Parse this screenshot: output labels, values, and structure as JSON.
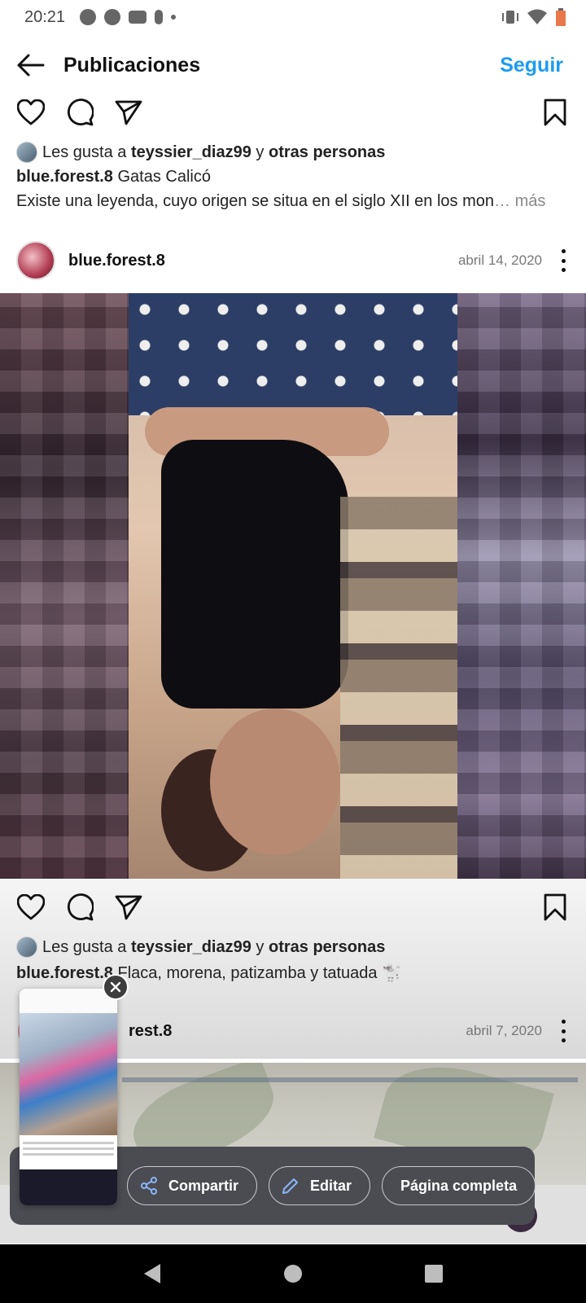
{
  "status_bar": {
    "time": "20:21"
  },
  "header": {
    "title": "Publicaciones",
    "follow_label": "Seguir"
  },
  "post1": {
    "likes": {
      "prefix": "Les gusta a ",
      "user": "teyssier_diaz99",
      "middle": " y ",
      "others": "otras personas"
    },
    "caption": {
      "username": "blue.forest.8",
      "text": " Gatas Calicó"
    },
    "caption_more": {
      "text": "Existe una leyenda, cuyo origen se situa en el siglo XII en los mon",
      "ellipsis": "…",
      "more": " más"
    }
  },
  "post2": {
    "username": "blue.forest.8",
    "date": "abril 14, 2020",
    "likes": {
      "prefix": "Les gusta a ",
      "user": "teyssier_diaz99",
      "middle": " y ",
      "others": "otras personas"
    },
    "caption": {
      "username": "blue.forest.8",
      "text": " Flaca, morena, patizamba y tatuada 🐩"
    }
  },
  "post3": {
    "username_partial": "rest.8",
    "date": "abril 7, 2020"
  },
  "share_panel": {
    "share_label": "Compartir",
    "edit_label": "Editar",
    "fullpage_label": "Página completa"
  },
  "icons": {
    "back": "arrow-left-icon",
    "like": "heart-icon",
    "comment": "comment-icon",
    "send": "send-icon",
    "save": "bookmark-icon",
    "more": "more-vertical-icon",
    "share": "share-icon",
    "edit": "pencil-icon",
    "close": "close-icon"
  },
  "colors": {
    "accent": "#1d9bf0",
    "panel": "#4b4c52"
  }
}
